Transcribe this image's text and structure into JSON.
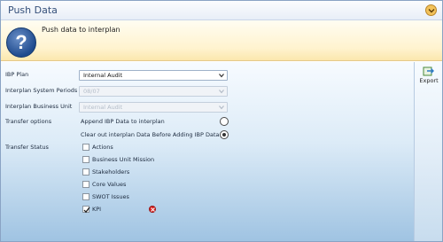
{
  "window": {
    "title": "Push Data"
  },
  "banner": {
    "message": "Push data to interplan",
    "icon": "question-icon"
  },
  "form": {
    "ibp_plan": {
      "label": "IBP Plan",
      "value": "Internal Audit"
    },
    "system_periods": {
      "label": "Interplan System Periods",
      "value": "08/07"
    },
    "business_unit": {
      "label": "Interplan Business Unit",
      "value": "Internal Audit"
    },
    "transfer_options": {
      "label": "Transfer options",
      "options": [
        {
          "label": "Append IBP Data to interplan",
          "selected": false
        },
        {
          "label": "Clear out interplan Data Before Adding IBP Data",
          "selected": true
        }
      ]
    },
    "transfer_status": {
      "label": "Transfer Status",
      "items": [
        {
          "label": "Actions",
          "checked": false
        },
        {
          "label": "Business Unit Mission",
          "checked": false
        },
        {
          "label": "Stakeholders",
          "checked": false
        },
        {
          "label": "Core Values",
          "checked": false
        },
        {
          "label": "SWOT Issues",
          "checked": false
        },
        {
          "label": "KPI",
          "checked": true,
          "error": true
        }
      ]
    }
  },
  "sidebar": {
    "export_label": "Export"
  },
  "colors": {
    "accent": "#1f4b8e",
    "error": "#dd2222",
    "banner": "#fff3cf"
  }
}
